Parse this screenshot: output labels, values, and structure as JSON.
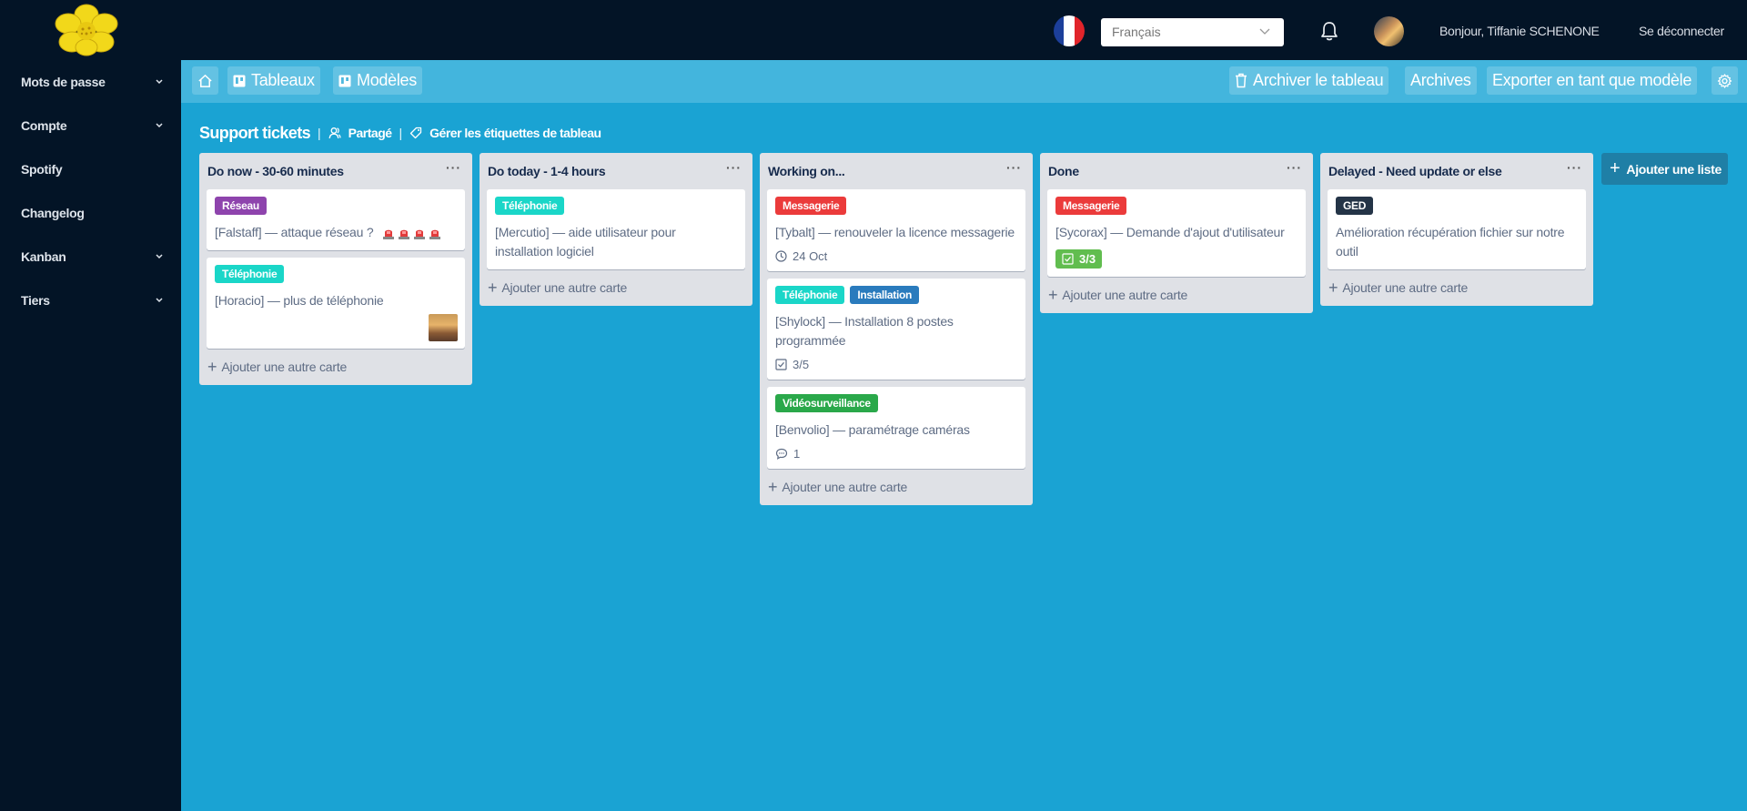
{
  "topbar": {
    "language": "Français",
    "greeting": "Bonjour, Tiffanie SCHENONE",
    "logout": "Se déconnecter",
    "flag_colors": [
      "#1c3f9a",
      "#ffffff",
      "#e1242a"
    ]
  },
  "sidebar": {
    "items": [
      {
        "label": "Mots de passe",
        "expandable": true
      },
      {
        "label": "Compte",
        "expandable": true
      },
      {
        "label": "Spotify",
        "expandable": false
      },
      {
        "label": "Changelog",
        "expandable": false
      },
      {
        "label": "Kanban",
        "expandable": true
      },
      {
        "label": "Tiers",
        "expandable": true
      }
    ]
  },
  "boardbar": {
    "boards": "Tableaux",
    "templates": "Modèles",
    "archive_board": "Archiver le tableau",
    "archives": "Archives",
    "export_template": "Exporter en tant que modèle"
  },
  "board": {
    "title": "Support tickets",
    "shared": "Partagé",
    "manage_labels": "Gérer les étiquettes de tableau"
  },
  "add_card_label": "Ajouter une autre carte",
  "add_list_label": "Ajouter une liste",
  "label_colors": {
    "reseau": "#8e44ad",
    "telephonie": "#1ad6c8",
    "messagerie": "#eb3b3b",
    "installation": "#2a7bbd",
    "videosurveillance": "#2aa84a",
    "ged": "#243447"
  },
  "lists": [
    {
      "title": "Do now - 30-60 minutes",
      "cards": [
        {
          "label": "Réseau",
          "text": "[Falstaff] — attaque réseau ?"
        },
        {
          "label": "Téléphonie",
          "text": "[Horacio] — plus de téléphonie"
        }
      ]
    },
    {
      "title": "Do today - 1-4 hours",
      "cards": [
        {
          "label": "Téléphonie",
          "text": "[Mercutio] — aide utilisateur pour installation logiciel"
        }
      ]
    },
    {
      "title": "Working on...",
      "cards": [
        {
          "label": "Messagerie",
          "text": "[Tybalt] — renouveler la licence messagerie",
          "due": "24 Oct"
        },
        {
          "labels": [
            "Téléphonie",
            "Installation"
          ],
          "text": "[Shylock] — Installation 8 postes programmée",
          "checklist": "3/5"
        },
        {
          "label": "Vidéosurveillance",
          "text": "[Benvolio] — paramétrage caméras",
          "comments": "1"
        }
      ]
    },
    {
      "title": "Done",
      "cards": [
        {
          "label": "Messagerie",
          "text": "[Sycorax] — Demande d'ajout d'utilisateur",
          "checklist": "3/3"
        }
      ]
    },
    {
      "title": "Delayed - Need update or else",
      "cards": [
        {
          "label": "GED",
          "text": "Amélioration récupération fichier sur notre outil"
        }
      ]
    }
  ]
}
